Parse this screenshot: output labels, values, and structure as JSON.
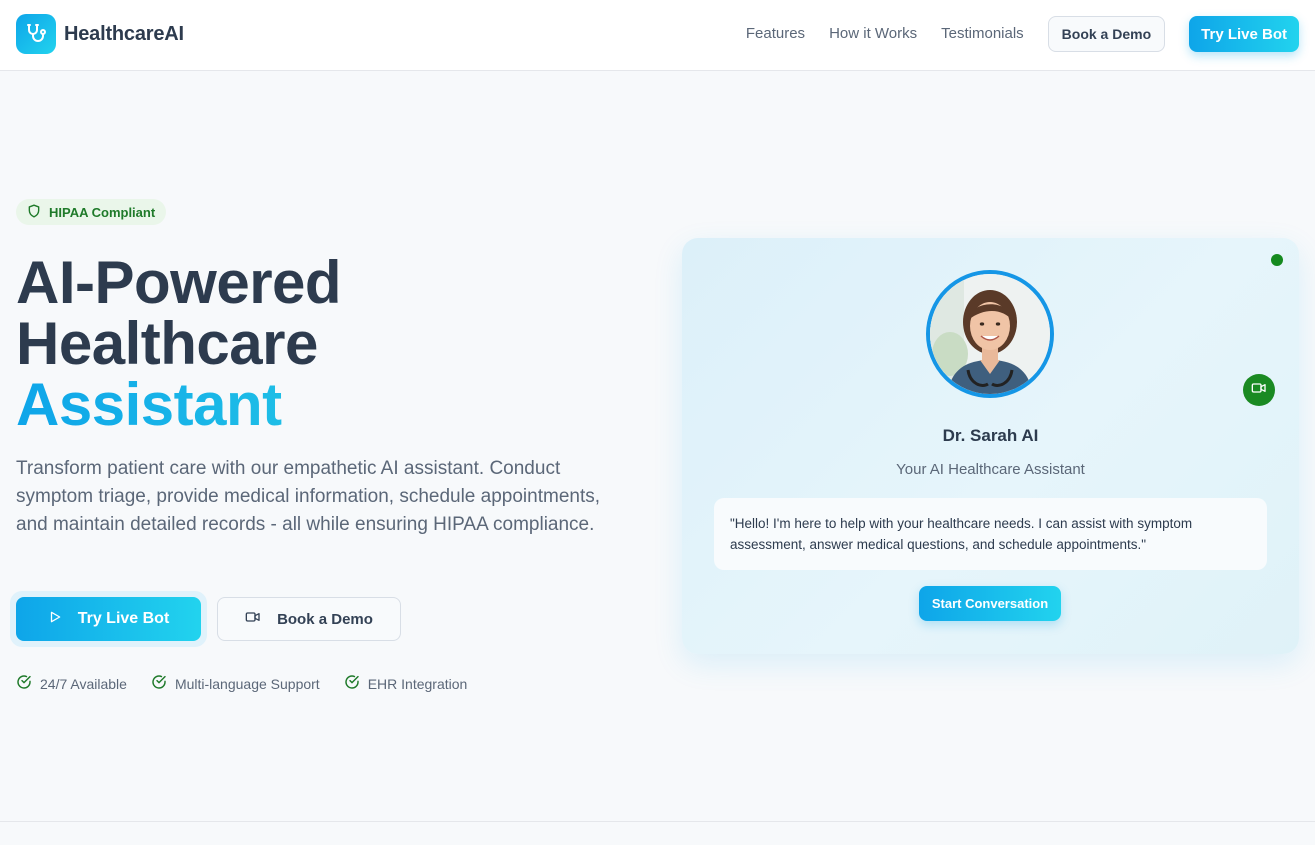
{
  "header": {
    "brand": "HealthcareAI",
    "nav": [
      "Features",
      "How it Works",
      "Testimonials"
    ],
    "demo_button": "Book a Demo",
    "try_button": "Try Live Bot"
  },
  "hero": {
    "badge": "HIPAA Compliant",
    "title_line1": "AI-Powered",
    "title_line2": "Healthcare",
    "title_accent": "Assistant",
    "description": "Transform patient care with our empathetic AI assistant. Conduct symptom triage, provide medical information, schedule appointments, and maintain detailed records - all while ensuring HIPAA compliance.",
    "primary_button": "Try Live Bot",
    "secondary_button": "Book a Demo",
    "features": [
      "24/7 Available",
      "Multi-language Support",
      "EHR Integration"
    ]
  },
  "assistant_card": {
    "name": "Dr. Sarah AI",
    "role": "Your AI Healthcare Assistant",
    "message": "\"Hello! I'm here to help with your healthcare needs. I can assist with symptom assessment, answer medical questions, and schedule appointments.\"",
    "start_button": "Start Conversation"
  },
  "colors": {
    "brand_gradient_start": "#0ea5e9",
    "brand_gradient_end": "#22d3ee",
    "heading": "#2d3b4e",
    "muted_text": "#5b6778",
    "success_green": "#1f7a2a",
    "online_dot": "#158a1f"
  },
  "icons": {
    "logo": "stethoscope-icon",
    "badge": "shield-icon",
    "try_button": "play-icon",
    "demo_button": "video-camera-icon",
    "features": "check-circle-icon",
    "card_video": "video-camera-icon"
  }
}
